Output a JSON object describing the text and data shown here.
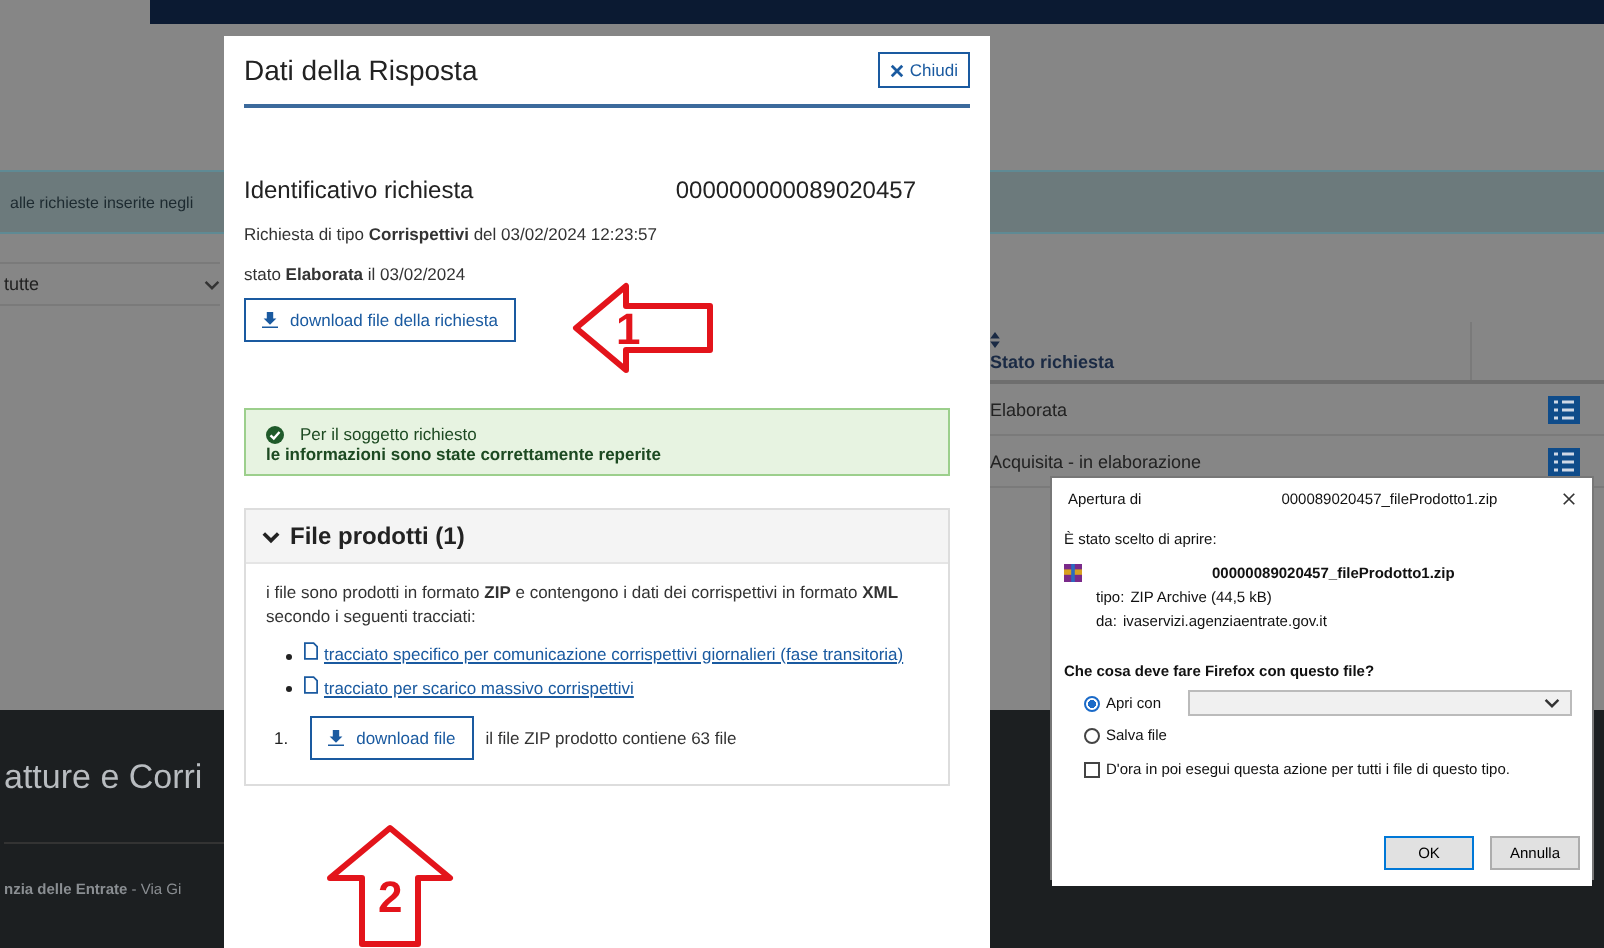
{
  "background": {
    "notice": "alle richieste inserite negli",
    "filter": "tutte",
    "table": {
      "column": "Stato richiesta",
      "rows": [
        "Elaborata",
        "Acquisita - in elaborazione"
      ]
    },
    "footer_title": "atture e Corri",
    "footer_address": "**nzia delle Entrate** - Via Gi"
  },
  "modal": {
    "title": "Dati della Risposta",
    "close_label": "Chiudi",
    "request_id_label": "Identificativo richiesta",
    "request_id": "000000000089020457",
    "details": [
      "Richiesta di tipo **Corrispettivi** del 03/02/2024 12:23:57",
      "stato **Elaborata** il 03/02/2024"
    ],
    "download_button": "download file della richiesta",
    "alert": {
      "lead": "Per il soggetto richiesto",
      "message": "le informazioni sono state correttamente reperite"
    },
    "panel": {
      "title": "File prodotti (1)",
      "expanded": true,
      "intro": "i file sono prodotti in formato **ZIP** e contengono i dati dei corrispettivi in formato **XML** secondo i seguenti tracciati:",
      "links": [
        "tracciato specifico per comunicazione corrispettivi giornalieri (fase transitoria)",
        "tracciato per scarico massivo corrispettivi"
      ],
      "files": [
        {
          "index": "1.",
          "button": "download file",
          "note": "il file ZIP prodotto contiene 63 file"
        }
      ]
    }
  },
  "annotations": [
    {
      "label": "1",
      "kind": "left"
    },
    {
      "label": "2",
      "kind": "up"
    }
  ],
  "dialog": {
    "title_prefix": "Apertura di",
    "title_file": "000089020457_fileProdotto1.zip",
    "intro": "È stato scelto di aprire:",
    "file_name": "00000089020457_fileProdotto1.zip",
    "type_label": "tipo:",
    "type": "ZIP Archive (44,5 kB)",
    "from_label": "da:",
    "from": "ivaservizi.agenziaentrate.gov.it",
    "question": "Che cosa deve fare Firefox con questo file?",
    "options": [
      {
        "label": "Apri con",
        "selected": true,
        "kind": "select"
      },
      {
        "label": "Salva file",
        "selected": false,
        "kind": "plain"
      }
    ],
    "remember": {
      "label": "D'ora in poi esegui questa azione per tutti i file di questo tipo.",
      "checked": false
    },
    "buttons": [
      "OK",
      "Annulla"
    ]
  }
}
